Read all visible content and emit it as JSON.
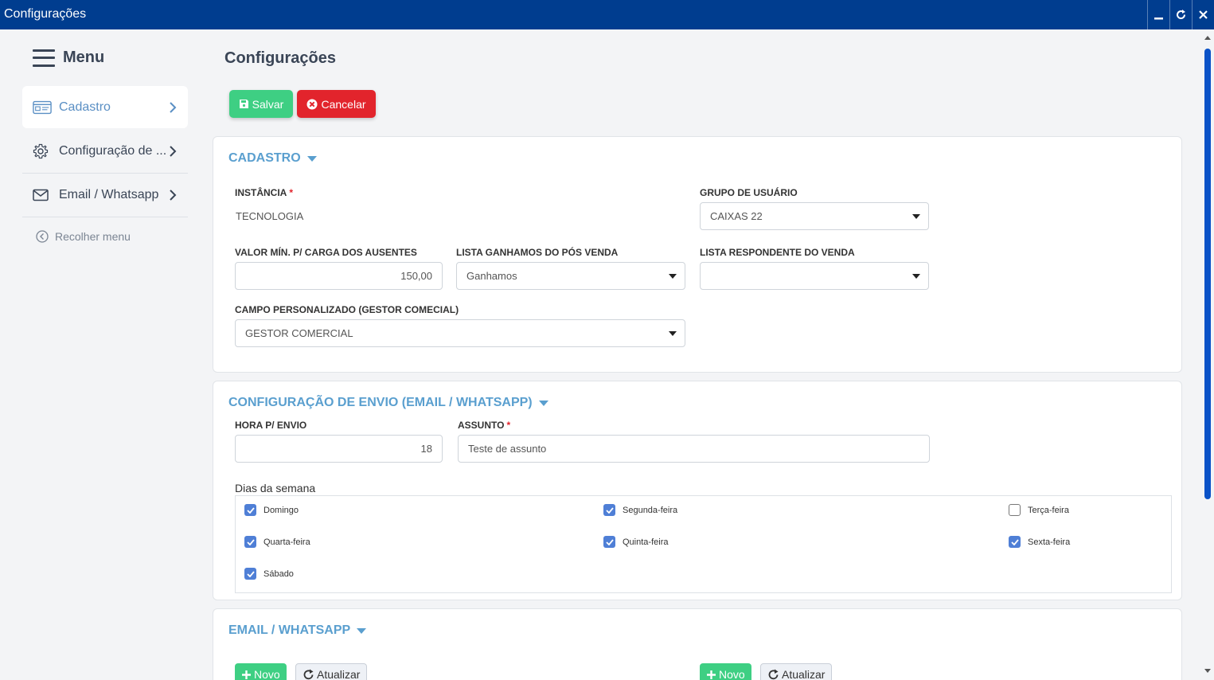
{
  "window": {
    "title": "Configurações"
  },
  "sidebar": {
    "menu_label": "Menu",
    "items": [
      {
        "label": "Cadastro",
        "icon": "id-card-icon"
      },
      {
        "label": "Configuração de ...",
        "icon": "gear-icon"
      },
      {
        "label": "Email / Whatsapp",
        "icon": "envelope-icon"
      }
    ],
    "collapse_label": "Recolher menu"
  },
  "main": {
    "title": "Configurações",
    "save_label": "Salvar",
    "cancel_label": "Cancelar",
    "cadastro": {
      "title": "CADASTRO",
      "instancia_label": "INSTÂNCIA",
      "instancia_value": "TECNOLOGIA",
      "grupo_label": "GRUPO DE USUÁRIO",
      "grupo_value": "CAIXAS 22",
      "valor_min_label": "VALOR MÍN. P/ CARGA DOS AUSENTES",
      "valor_min_value": "150,00",
      "lista_ganhamos_label": "LISTA GANHAMOS DO PÓS VENDA",
      "lista_ganhamos_value": "Ganhamos",
      "lista_respondente_label": "LISTA RESPONDENTE DO VENDA",
      "lista_respondente_value": "",
      "campo_label": "CAMPO PERSONALIZADO (GESTOR COMECIAL)",
      "campo_value": "GESTOR COMERCIAL"
    },
    "envio": {
      "title": "CONFIGURAÇÃO DE ENVIO (EMAIL / WHATSAPP)",
      "hora_label": "HORA P/ ENVIO",
      "hora_value": "18",
      "assunto_label": "ASSUNTO",
      "assunto_value": "Teste de assunto",
      "dias_label": "Dias da semana",
      "dias": [
        {
          "label": "Domingo",
          "checked": true
        },
        {
          "label": "Segunda-feira",
          "checked": true
        },
        {
          "label": "Terça-feira",
          "checked": false
        },
        {
          "label": "Quarta-feira",
          "checked": true
        },
        {
          "label": "Quinta-feira",
          "checked": true
        },
        {
          "label": "Sexta-feira",
          "checked": true
        },
        {
          "label": "Sábado",
          "checked": true
        }
      ]
    },
    "email_whatsapp": {
      "title": "EMAIL / WHATSAPP",
      "novo_label": "Novo",
      "atualizar_label": "Atualizar"
    }
  },
  "required_marker": "*"
}
